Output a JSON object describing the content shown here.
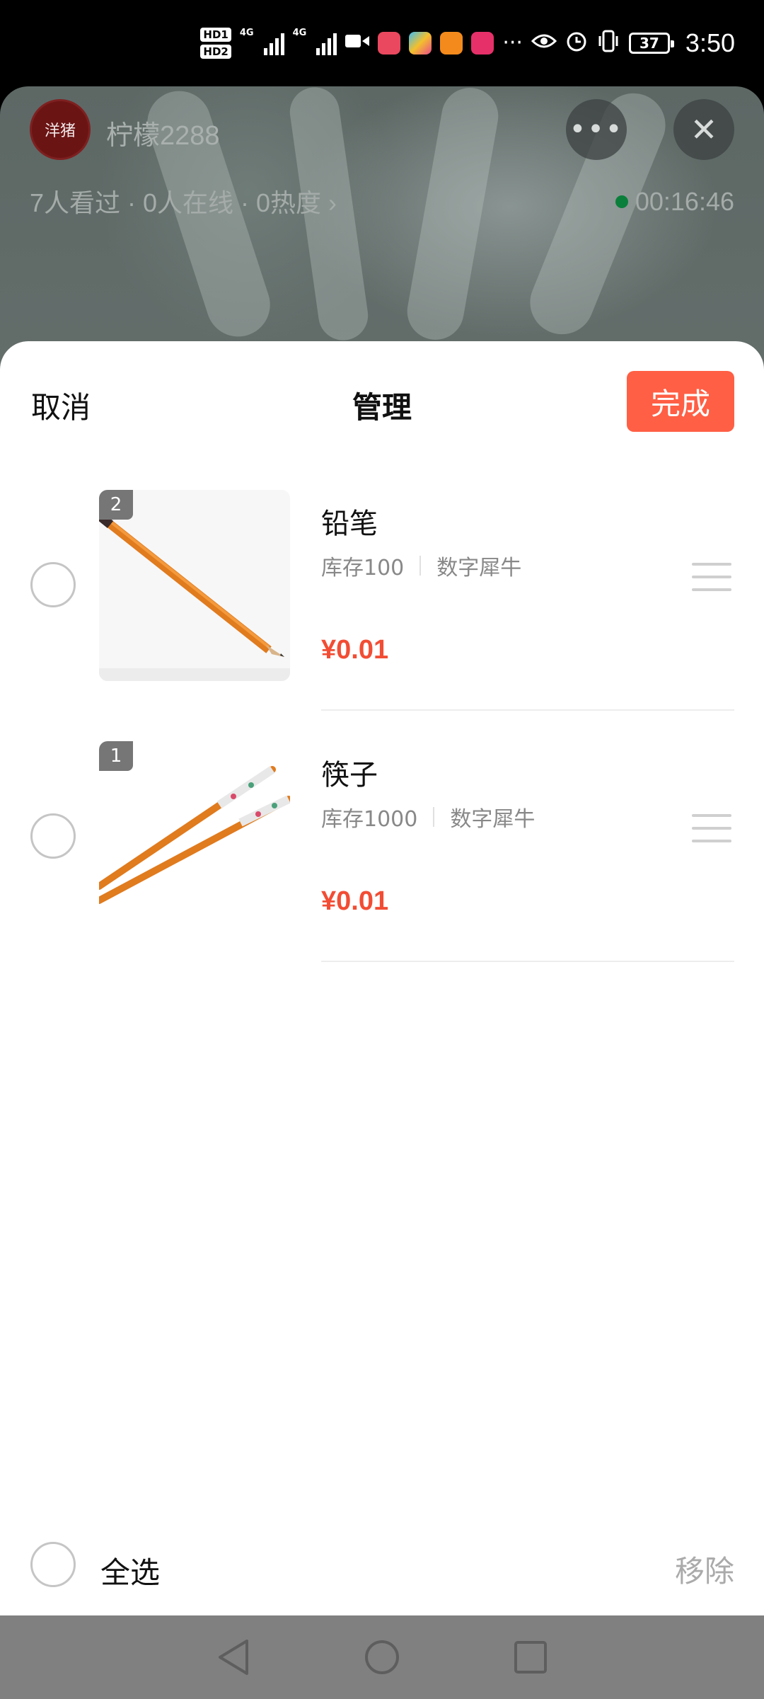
{
  "status_bar": {
    "hd1": "HD1",
    "hd2": "HD2",
    "net1": "4G",
    "net2": "4G",
    "more": "···",
    "battery": "37",
    "time": "3:50"
  },
  "live": {
    "streamer_name": "柠檬2288",
    "stats": "7人看过 · 0人在线 · 0热度 ›",
    "timer": "00:16:46",
    "more_label": "•••",
    "close_label": "✕",
    "avatar_text": "洋猪"
  },
  "sheet": {
    "cancel_label": "取消",
    "title": "管理",
    "done_label": "完成",
    "select_all_label": "全选",
    "remove_label": "移除"
  },
  "products": [
    {
      "rank": "2",
      "name": "铅笔",
      "stock": "库存100",
      "shop": "数字犀牛",
      "price": "¥0.01"
    },
    {
      "rank": "1",
      "name": "筷子",
      "stock": "库存1000",
      "shop": "数字犀牛",
      "price": "¥0.01"
    }
  ],
  "colors": {
    "accent": "#ff5f45",
    "price": "#f24d34",
    "live_dot": "#0a7f3b"
  },
  "icons": {
    "back": "triangle-back-icon",
    "home": "circle-home-icon",
    "recents": "square-recents-icon"
  }
}
